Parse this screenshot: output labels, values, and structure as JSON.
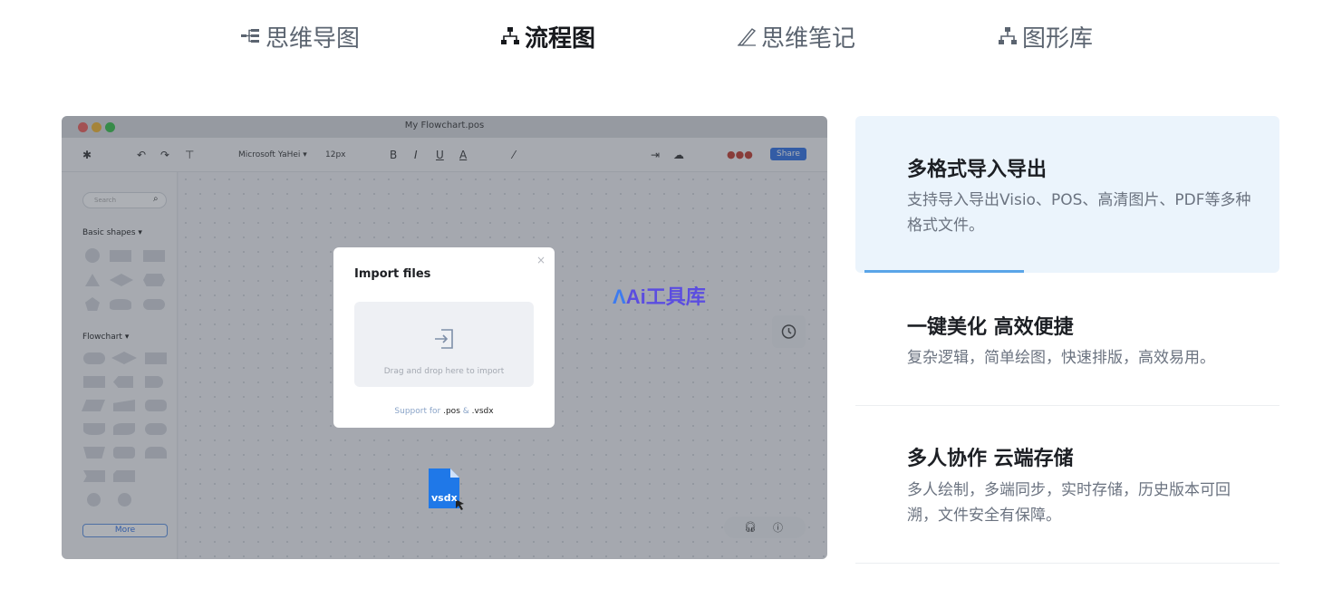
{
  "tabs": [
    {
      "label": "思维导图",
      "icon": "mindmap-icon",
      "active": false
    },
    {
      "label": "流程图",
      "icon": "flowchart-icon",
      "active": true
    },
    {
      "label": "思维笔记",
      "icon": "pen-icon",
      "active": false
    },
    {
      "label": "图形库",
      "icon": "shapes-library-icon",
      "active": false
    }
  ],
  "window": {
    "title": "My Flowchart.pos",
    "toolbar": {
      "font_name": "Microsoft  YaHei",
      "font_size": "12px",
      "bold": "B",
      "italic": "I",
      "underline": "U",
      "font_color": "A",
      "share_label": "Share"
    },
    "sidebar": {
      "search_placeholder": "Search",
      "basic_shapes_label": "Basic shapes",
      "flowchart_label": "Flowchart",
      "more_label": "More"
    },
    "dialog": {
      "title": "Import files",
      "close": "×",
      "dropzone_text": "Drag and drop here to import",
      "support_prefix": "Support for ",
      "ext_pos": ".pos",
      "amp": " & ",
      "ext_vsdx": ".vsdx"
    },
    "watermark": "Ai工具库",
    "dragged_file_label": "vsdx"
  },
  "features": [
    {
      "title": "多格式导入导出",
      "desc": "支持导入导出Visio、POS、高清图片、PDF等多种格式文件。",
      "active": true
    },
    {
      "title": "一键美化 高效便捷",
      "desc": "复杂逻辑，简单绘图，快速排版，高效易用。",
      "active": false
    },
    {
      "title": "多人协作 云端存储",
      "desc": "多人绘制，多端同步，实时存储，历史版本可回溯，文件安全有保障。",
      "active": false
    }
  ],
  "colors": {
    "accent": "#2d6fe3",
    "active_card_bg": "#ebf4fc",
    "progress": "#5aa5e8"
  }
}
